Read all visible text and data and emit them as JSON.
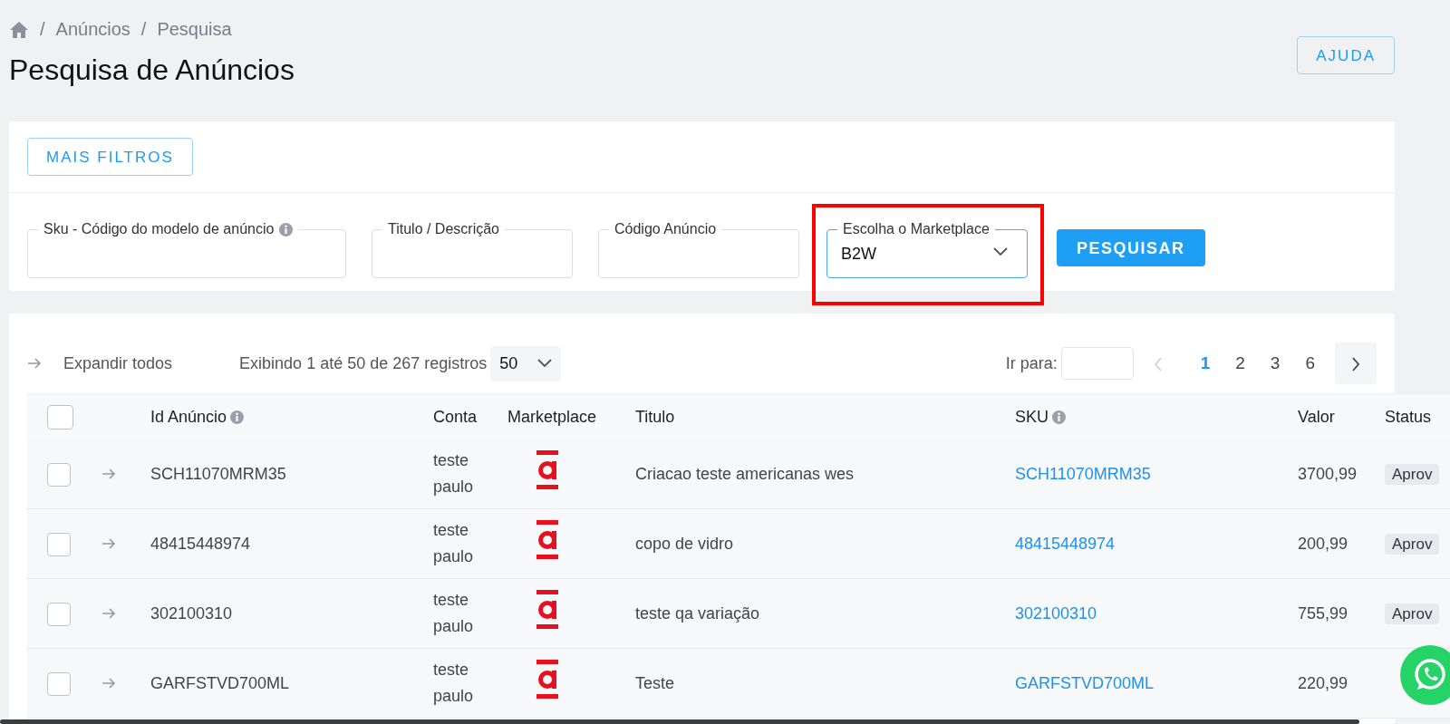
{
  "breadcrumb": [
    {
      "kind": "home"
    },
    {
      "kind": "separator",
      "text": "/"
    },
    {
      "kind": "link",
      "text": "Anúncios"
    },
    {
      "kind": "separator",
      "text": "/"
    },
    {
      "kind": "current",
      "text": "Pesquisa"
    }
  ],
  "title": "Pesquisa de Anúncios",
  "help_button": "AJUDA",
  "filters": {
    "more_button": "MAIS FILTROS",
    "fields": [
      {
        "kind": "input",
        "label": "Sku - Código do modelo de anúncio",
        "info_icon": true,
        "focused": false,
        "highlighted": false
      },
      {
        "kind": "input",
        "label": "Titulo / Descrição",
        "info_icon": false,
        "focused": false,
        "highlighted": false
      },
      {
        "kind": "input",
        "label": "Código Anúncio",
        "info_icon": false,
        "focused": false,
        "highlighted": false
      },
      {
        "kind": "select",
        "label": "Escolha o Marketplace",
        "value": "B2W",
        "info_icon": false,
        "focused": true,
        "highlighted": true
      }
    ],
    "search_button": "PESQUISAR"
  },
  "toolbar": {
    "expand_all": "Expandir todos",
    "summary": "Exibindo 1 até 50 de 267 registros",
    "page_size": "50",
    "goto_label": "Ir para:",
    "prev_disabled": true,
    "pages": [
      {
        "label": "1",
        "selected": true
      },
      {
        "label": "2",
        "selected": false
      },
      {
        "label": "3",
        "selected": false
      },
      {
        "label": "6",
        "selected": false
      }
    ]
  },
  "table": {
    "header_checked": false,
    "columns": [
      {
        "kind": "checkbox"
      },
      {
        "kind": "expand"
      },
      {
        "kind": "text",
        "label": "Id Anúncio",
        "info_icon": true
      },
      {
        "kind": "text",
        "label": "Conta",
        "info_icon": false
      },
      {
        "kind": "text",
        "label": "Marketplace",
        "info_icon": false
      },
      {
        "kind": "text",
        "label": "Titulo",
        "info_icon": false
      },
      {
        "kind": "text",
        "label": "SKU",
        "info_icon": true
      },
      {
        "kind": "text",
        "label": "Valor",
        "info_icon": false
      },
      {
        "kind": "text",
        "label": "Status",
        "info_icon": false
      }
    ],
    "rows": [
      {
        "checked": false,
        "id": "SCH11070MRM35",
        "conta": "teste paulo",
        "titulo": "Criacao teste americanas wes",
        "sku": "SCH11070MRM35",
        "valor": "3700,99",
        "status": "Aprov"
      },
      {
        "checked": false,
        "id": "48415448974",
        "conta": "teste paulo",
        "titulo": "copo de vidro",
        "sku": "48415448974",
        "valor": "200,99",
        "status": "Aprov"
      },
      {
        "checked": false,
        "id": "302100310",
        "conta": "teste paulo",
        "titulo": "teste qa variação",
        "sku": "302100310",
        "valor": "755,99",
        "status": "Aprov"
      },
      {
        "checked": false,
        "id": "GARFSTVD700ML",
        "conta": "teste paulo",
        "titulo": "Teste",
        "sku": "GARFSTVD700ML",
        "valor": "220,99"
      }
    ]
  }
}
